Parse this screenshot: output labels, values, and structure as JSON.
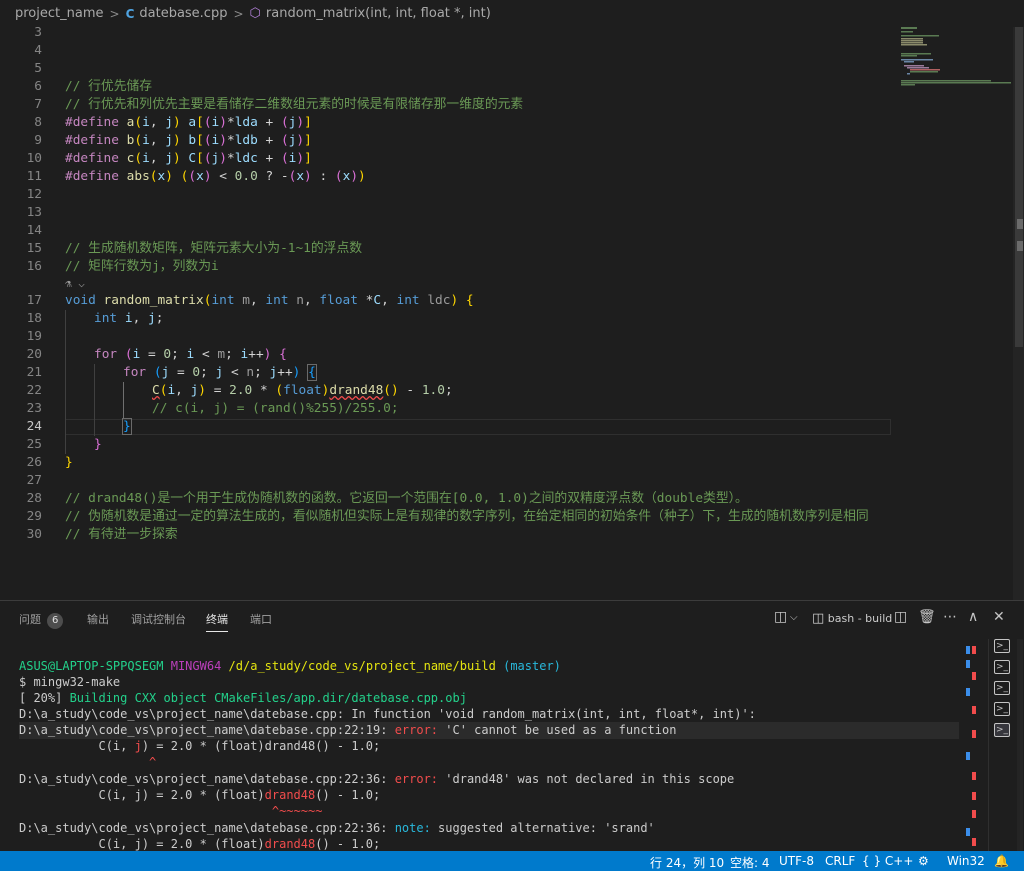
{
  "breadcrumb": {
    "project": "project_name",
    "file": "datebase.cpp",
    "file_icon": "C",
    "symbol": "random_matrix(int, int, float *, int)"
  },
  "editor": {
    "line_numbers": [
      "3",
      "4",
      "5",
      "6",
      "7",
      "8",
      "9",
      "10",
      "11",
      "12",
      "13",
      "14",
      "15",
      "16",
      "17",
      "18",
      "19",
      "20",
      "21",
      "22",
      "23",
      "24",
      "25",
      "26",
      "27",
      "28",
      "29",
      "30"
    ],
    "comments": {
      "c6": "// 行优先储存",
      "c7": "// 行优先和列优先主要是看储存二维数组元素的时候是有限储存那一维度的元素",
      "c15": "// 生成随机数矩阵，矩阵元素大小为-1~1的浮点数",
      "c16": "// 矩阵行数为j，列数为i",
      "c23": "// c(i, j) = (rand()%255)/255.0;",
      "c28": "// drand48()是一个用于生成伪随机数的函数。它返回一个范围在[0.0, 1.0)之间的双精度浮点数（double类型）。",
      "c29": "// 伪随机数是通过一定的算法生成的，看似随机但实际上是有规律的数字序列，在给定相同的初始条件（种子）下，生成的随机数序列是相同",
      "c30": "// 有待进一步探索"
    },
    "kw": {
      "define": "#define",
      "void": "void",
      "int": "int",
      "float": "float",
      "for": "for"
    },
    "macros": {
      "a": "a",
      "b": "b",
      "c": "c",
      "abs": "abs",
      "C": "C"
    },
    "params": {
      "i": "i",
      "j": "j",
      "x": "x",
      "lda": "lda",
      "ldb": "ldb",
      "ldc": "ldc",
      "m": "m",
      "n": "n",
      "Cp": "C"
    },
    "arrays": {
      "a": "a",
      "b": "b",
      "C": "C"
    },
    "nums": {
      "zero": "0.0",
      "two": "2.0",
      "one": "1.0",
      "izero": "0"
    },
    "funcs": {
      "random_matrix": "random_matrix",
      "drand48": "drand48"
    },
    "codelens_icon": "⚗ ⌵"
  },
  "panel": {
    "tabs": [
      {
        "label": "问题",
        "badge": "6"
      },
      {
        "label": "输出"
      },
      {
        "label": "调试控制台"
      },
      {
        "label": "终端"
      },
      {
        "label": "端口"
      }
    ],
    "terminal_name": "bash - build",
    "terminal": {
      "prompt_user": "ASUS@LAPTOP-SPPQSEGM",
      "prompt_env": "MINGW64",
      "prompt_path": "/d/a_study/code_vs/project_name/build",
      "prompt_branch": "(master)",
      "cmd_prefix": "$ ",
      "cmd": "mingw32-make",
      "build_pct": "[ 20%] ",
      "build_msg": "Building CXX object CMakeFiles/app.dir/datebase.cpp.obj",
      "fn_line": "D:\\a_study\\code_vs\\project_name\\datebase.cpp: In function 'void random_matrix(int, int, float*, int)':",
      "e1_loc": "D:\\a_study\\code_vs\\project_name\\datebase.cpp:22:19: ",
      "e1_kind": "error:",
      "e1_msg": " 'C' cannot be used as a function",
      "e1_code_pre": "           C(i, ",
      "e1_code_hl": "j",
      "e1_code_post": ") = 2.0 * (float)drand48() - 1.0;",
      "e1_caret": "                  ^",
      "e2_loc": "D:\\a_study\\code_vs\\project_name\\datebase.cpp:22:36: ",
      "e2_kind": "error:",
      "e2_msg": " 'drand48' was not declared in this scope",
      "e2_code_pre": "           C(i, j) = 2.0 * (float)",
      "e2_code_hl": "drand48",
      "e2_code_post": "() - 1.0;",
      "e2_caret": "                                   ^~~~~~~",
      "n_loc": "D:\\a_study\\code_vs\\project_name\\datebase.cpp:22:36: ",
      "n_kind": "note:",
      "n_msg": " suggested alternative: 'srand'",
      "n_code_pre": "           C(i, j) = 2.0 * (float)",
      "n_code_hl": "drand48",
      "n_code_post": "() - 1.0;"
    }
  },
  "status": {
    "position": "行 24，列 10",
    "spaces": "空格: 4",
    "encoding": "UTF-8",
    "eol": "CRLF",
    "language": "C++",
    "platform": "Win32",
    "lang_icon": "{ }"
  }
}
